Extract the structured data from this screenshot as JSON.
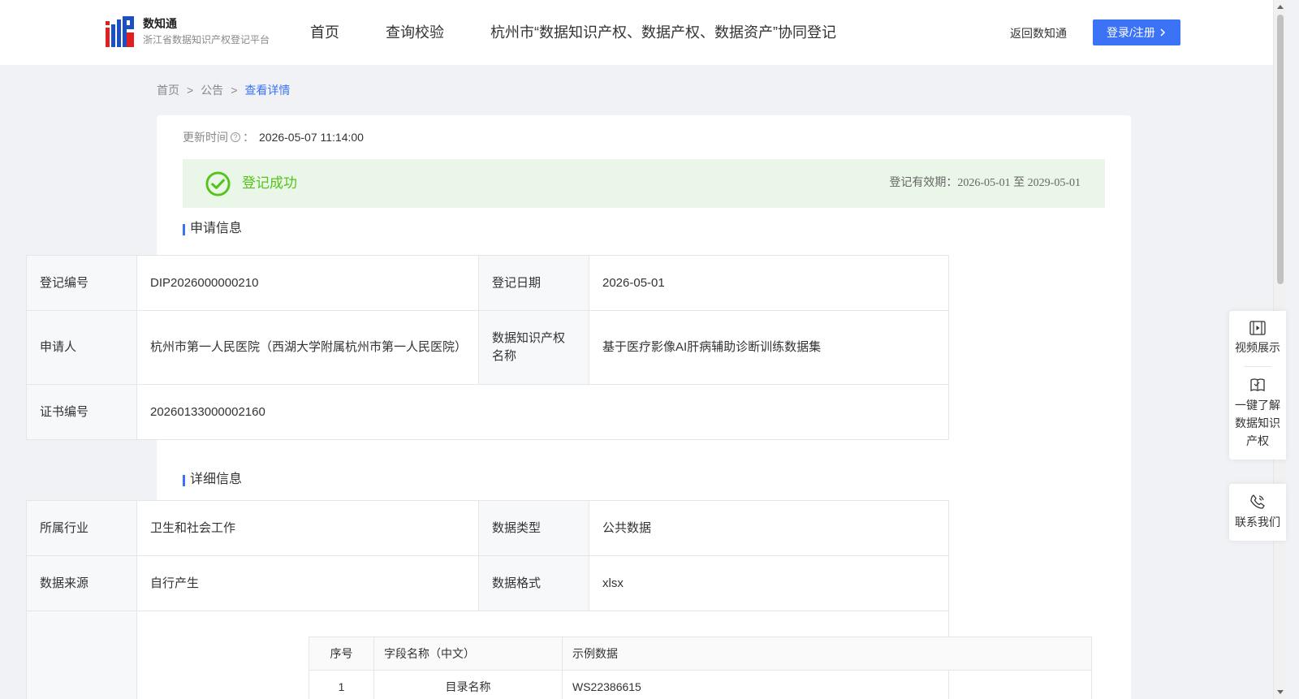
{
  "header": {
    "logo_name": "数知通",
    "logo_subtitle": "浙江省数据知识产权登记平台",
    "nav": [
      "首页",
      "查询校验",
      "杭州市“数据知识产权、数据产权、数据资产”协同登记"
    ],
    "back_link": "返回数知通",
    "login_label": "登录/注册"
  },
  "breadcrumb": {
    "home": "首页",
    "sep": ">",
    "notice": "公告",
    "current": "查看详情"
  },
  "update": {
    "label": "更新时间",
    "colon": "：",
    "value": "2026-05-07 11:14:00"
  },
  "status": {
    "text": "登记成功",
    "validity": "登记有效期：2026-05-01 至 2029-05-01"
  },
  "application": {
    "title": "申请信息",
    "reg_no_label": "登记编号",
    "reg_no": "DIP2026000000210",
    "reg_date_label": "登记日期",
    "reg_date": "2026-05-01",
    "applicant_label": "申请人",
    "applicant": "杭州市第一人民医院（西湖大学附属杭州市第一人民医院）",
    "ip_name_label": "数据知识产权名称",
    "ip_name": "基于医疗影像AI肝病辅助诊断训练数据集",
    "cert_no_label": "证书编号",
    "cert_no": "20260133000002160"
  },
  "detail": {
    "title": "详细信息",
    "industry_label": "所属行业",
    "industry": "卫生和社会工作",
    "data_type_label": "数据类型",
    "data_type": "公共数据",
    "source_label": "数据来源",
    "source": "自行产生",
    "format_label": "数据格式",
    "format": "xlsx",
    "fields_table": {
      "headers": [
        "序号",
        "字段名称（中文）",
        "示例数据"
      ],
      "rows": [
        [
          "1",
          "目录名称",
          "WS22386615"
        ]
      ]
    }
  },
  "side": {
    "video": "视频展示",
    "learn": "一键了解数据知识产权",
    "contact": "联系我们"
  },
  "colors": {
    "primary": "#3b72f6",
    "success": "#52c41a",
    "success_bg": "#eaf6e7"
  }
}
